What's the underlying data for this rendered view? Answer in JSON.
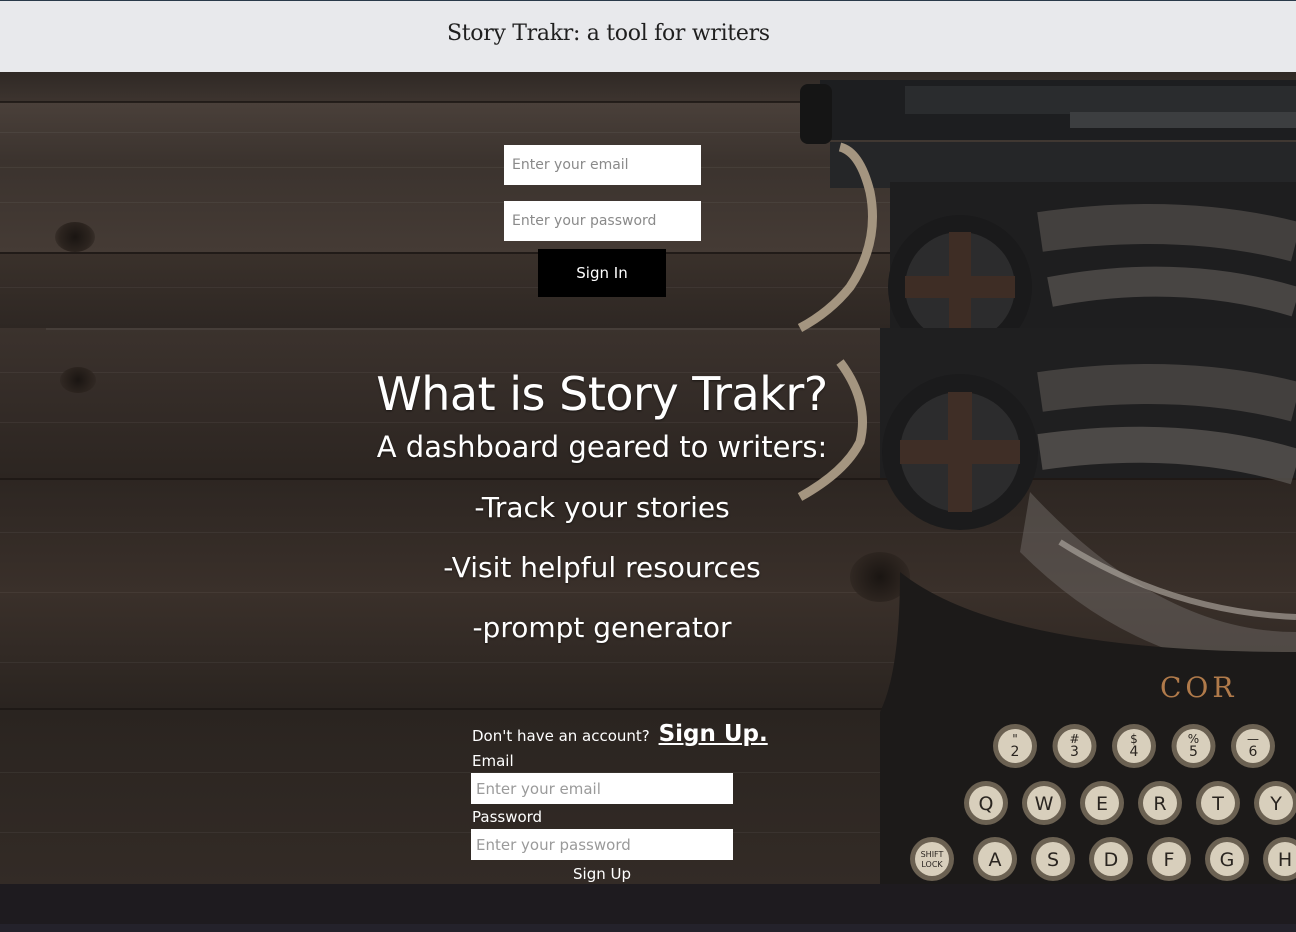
{
  "navbar": {
    "brand": "Story Trakr: a tool for writers"
  },
  "signin": {
    "email_placeholder": "Enter your email",
    "password_placeholder": "Enter your password",
    "button_label": "Sign In"
  },
  "about": {
    "title": "What is Story Trakr?",
    "subtitle": "A dashboard geared to writers:",
    "features": [
      "-Track your stories",
      "-Visit helpful resources",
      "-prompt generator"
    ]
  },
  "signup": {
    "prompt": "Don't have an account?",
    "link_label": "Sign Up.",
    "email_label": "Email",
    "email_placeholder": "Enter your email",
    "password_label": "Password",
    "password_placeholder": "Enter your password",
    "button_label": "Sign Up"
  },
  "typewriter_keys": {
    "numbers": [
      "2",
      "3",
      "4",
      "5",
      "6"
    ],
    "number_symbols": [
      "\"",
      "#",
      "$",
      "%",
      "—"
    ],
    "row_top": [
      "Q",
      "W",
      "E",
      "R",
      "T",
      "Y"
    ],
    "row_middle": [
      "A",
      "S",
      "D",
      "F",
      "G",
      "H"
    ],
    "shift_key": [
      "SHIFT",
      "LOCK"
    ],
    "brand_fragment": "COR"
  }
}
